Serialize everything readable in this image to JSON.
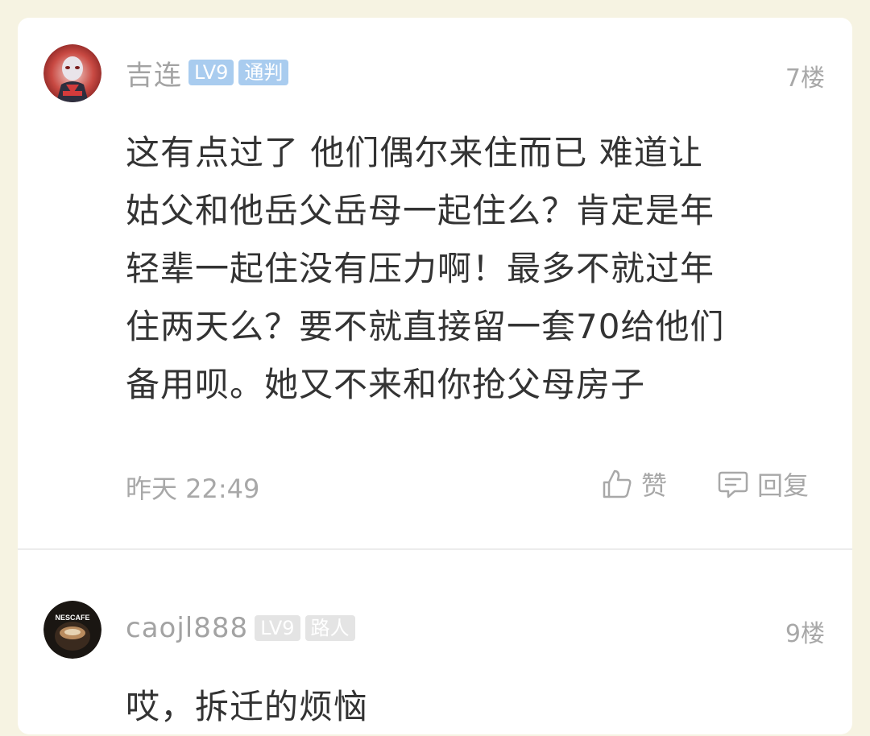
{
  "comments": [
    {
      "username": "吉连",
      "level": "LV9",
      "role": "通判",
      "floor": "7楼",
      "body_lines": [
        "这有点过了 他们偶尔来住而已 难道让",
        "姑父和他岳父岳母一起住么？肯定是年",
        "轻辈一起住没有压力啊！最多不就过年",
        "住两天么？要不就直接留一套70给他们",
        "备用呗。她又不来和你抢父母房子"
      ],
      "timestamp": "昨天 22:49",
      "like_label": "赞",
      "reply_label": "回复",
      "avatar_icon": "cartoon-character-avatar"
    },
    {
      "username": "caojl888",
      "level": "LV9",
      "role": "路人",
      "floor": "9楼",
      "body_lines": [
        "哎，拆迁的烦恼"
      ],
      "avatar_icon": "coffee-cup-avatar",
      "avatar_text": "NESCAFE"
    }
  ],
  "colors": {
    "background": "#f6f3e2",
    "card": "#ffffff",
    "badge_blue": "#a9ccef",
    "badge_gray": "#e4e4e4",
    "muted_text": "#a8a8a8",
    "body_text": "#333333"
  }
}
